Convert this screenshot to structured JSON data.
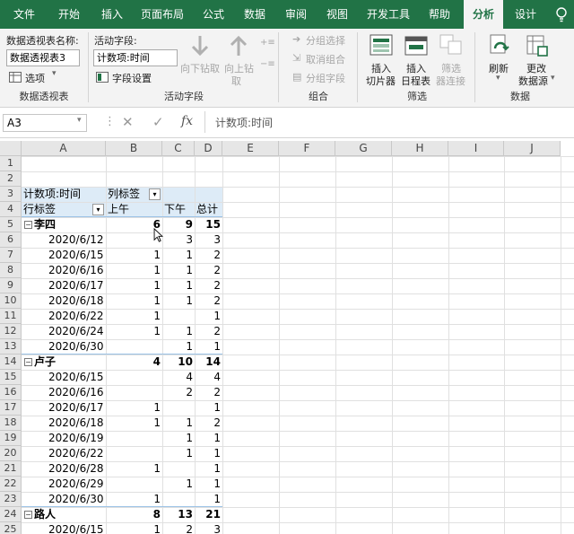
{
  "tabs": [
    "文件",
    "开始",
    "插入",
    "页面布局",
    "公式",
    "数据",
    "审阅",
    "视图",
    "开发工具",
    "帮助",
    "分析",
    "设计"
  ],
  "ribbon": {
    "pivot_name_label": "数据透视表名称:",
    "pivot_name_value": "数据透视表3",
    "options_label": "选项",
    "group_pivot": "数据透视表",
    "active_field_label": "活动字段:",
    "active_field_value": "计数项:时间",
    "field_settings_label": "字段设置",
    "drill_down": "向下钻取",
    "drill_up": "向上钻",
    "drill_up_2": "取",
    "group_active_field": "活动字段",
    "group_selection": "分组选择",
    "ungroup": "取消组合",
    "group_field": "分组字段",
    "group_group": "组合",
    "insert_slicer": [
      "插入",
      "切片器"
    ],
    "insert_timeline": [
      "插入",
      "日程表"
    ],
    "filter_connections": [
      "筛选",
      "器连接"
    ],
    "group_filter": "筛选",
    "refresh": "刷新",
    "change_source": [
      "更改",
      "数据源"
    ],
    "group_data": "数据"
  },
  "formula_bar": {
    "name_box": "A3",
    "fx": "fx",
    "content": "计数项:时间"
  },
  "columns": [
    "A",
    "B",
    "C",
    "D",
    "E",
    "F",
    "G",
    "H",
    "I",
    "J"
  ],
  "rows": [
    "1",
    "2",
    "3",
    "4",
    "5",
    "6",
    "7",
    "8",
    "9",
    "10",
    "11",
    "12",
    "13",
    "14",
    "15",
    "16",
    "17",
    "18",
    "19",
    "20",
    "21",
    "22",
    "23",
    "24",
    "25"
  ],
  "pivot": {
    "header": {
      "count_label": "计数项:时间",
      "col_label": "列标签",
      "row_label": "行标签",
      "am": "上午",
      "pm": "下午",
      "total": "总计"
    },
    "groups": [
      {
        "name": "李四",
        "am": "6",
        "pm": "9",
        "total": "15",
        "items": [
          {
            "date": "2020/6/12",
            "am": "",
            "pm": "3",
            "total": "3"
          },
          {
            "date": "2020/6/15",
            "am": "1",
            "pm": "1",
            "total": "2"
          },
          {
            "date": "2020/6/16",
            "am": "1",
            "pm": "1",
            "total": "2"
          },
          {
            "date": "2020/6/17",
            "am": "1",
            "pm": "1",
            "total": "2"
          },
          {
            "date": "2020/6/18",
            "am": "1",
            "pm": "1",
            "total": "2"
          },
          {
            "date": "2020/6/22",
            "am": "1",
            "pm": "",
            "total": "1"
          },
          {
            "date": "2020/6/24",
            "am": "1",
            "pm": "1",
            "total": "2"
          },
          {
            "date": "2020/6/30",
            "am": "",
            "pm": "1",
            "total": "1"
          }
        ]
      },
      {
        "name": "卢子",
        "am": "4",
        "pm": "10",
        "total": "14",
        "items": [
          {
            "date": "2020/6/15",
            "am": "",
            "pm": "4",
            "total": "4"
          },
          {
            "date": "2020/6/16",
            "am": "",
            "pm": "2",
            "total": "2"
          },
          {
            "date": "2020/6/17",
            "am": "1",
            "pm": "",
            "total": "1"
          },
          {
            "date": "2020/6/18",
            "am": "1",
            "pm": "1",
            "total": "2"
          },
          {
            "date": "2020/6/19",
            "am": "",
            "pm": "1",
            "total": "1"
          },
          {
            "date": "2020/6/22",
            "am": "",
            "pm": "1",
            "total": "1"
          },
          {
            "date": "2020/6/28",
            "am": "1",
            "pm": "",
            "total": "1"
          },
          {
            "date": "2020/6/29",
            "am": "",
            "pm": "1",
            "total": "1"
          },
          {
            "date": "2020/6/30",
            "am": "1",
            "pm": "",
            "total": "1"
          }
        ]
      },
      {
        "name": "路人",
        "am": "8",
        "pm": "13",
        "total": "21",
        "items": [
          {
            "date": "2020/6/15",
            "am": "1",
            "pm": "2",
            "total": "3"
          }
        ]
      }
    ]
  },
  "colors": {
    "excel_green": "#217346",
    "pivot_header": "#ddebf7"
  }
}
